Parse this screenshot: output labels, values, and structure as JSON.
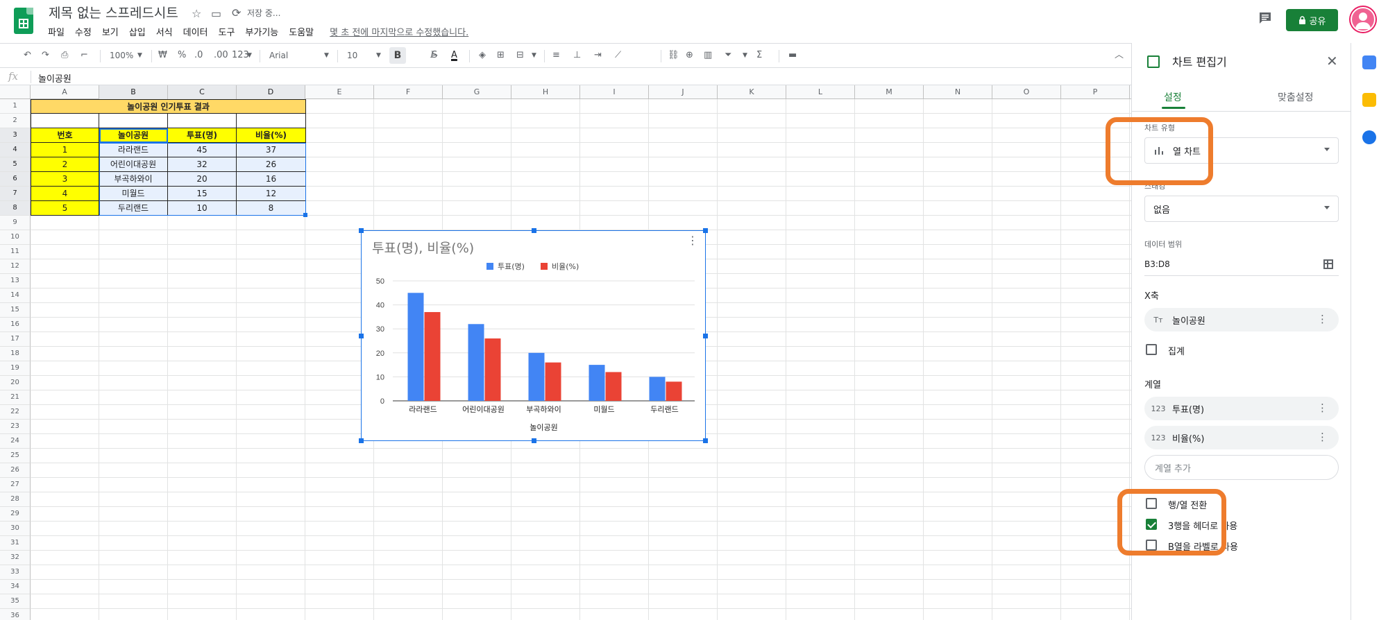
{
  "header": {
    "doc_title": "제목 없는 스프레드시트",
    "saving": "저장 중...",
    "menu": [
      "파일",
      "수정",
      "보기",
      "삽입",
      "서식",
      "데이터",
      "도구",
      "부가기능",
      "도움말"
    ],
    "last_edit": "몇 초 전에 마지막으로 수정했습니다.",
    "share_label": "공유"
  },
  "toolbar": {
    "zoom": "100%",
    "currency": "₩",
    "percent": "%",
    "dec_decrease": ".0",
    "dec_increase": ".00",
    "format": "123",
    "font": "Arial",
    "font_size": "10",
    "bold": "B",
    "italic": "I",
    "strike": "S",
    "text_color": "A",
    "sigma": "Σ"
  },
  "formula": {
    "fx": "fx",
    "value": "놀이공원"
  },
  "grid": {
    "columns": [
      "A",
      "B",
      "C",
      "D",
      "E",
      "F",
      "G",
      "H",
      "I",
      "J",
      "K",
      "L",
      "M",
      "N",
      "O",
      "P"
    ],
    "rows": [
      "1",
      "2",
      "3",
      "4",
      "5",
      "6",
      "7",
      "8",
      "9",
      "10",
      "11",
      "12",
      "13",
      "14",
      "15",
      "16",
      "17",
      "18",
      "19",
      "20",
      "21",
      "22",
      "23",
      "24",
      "25",
      "26",
      "27",
      "28",
      "29",
      "30",
      "31",
      "32",
      "33",
      "34",
      "35",
      "36"
    ],
    "table_title": "놀이공원 인기투표 결과",
    "headers": [
      "번호",
      "놀이공원",
      "투표(명)",
      "비율(%)"
    ],
    "table_rows": [
      [
        "1",
        "라라랜드",
        "45",
        "37"
      ],
      [
        "2",
        "어린이대공원",
        "32",
        "26"
      ],
      [
        "3",
        "부곡하와이",
        "20",
        "16"
      ],
      [
        "4",
        "미월드",
        "15",
        "12"
      ],
      [
        "5",
        "두리랜드",
        "10",
        "8"
      ]
    ]
  },
  "chart": {
    "title": "투표(명), 비율(%)",
    "menu_icon": "⋮"
  },
  "chart_data": {
    "type": "bar",
    "title": "투표(명), 비율(%)",
    "categories": [
      "라라랜드",
      "어린이대공원",
      "부곡하와이",
      "미월드",
      "두리랜드"
    ],
    "series": [
      {
        "name": "투표(명)",
        "values": [
          45,
          32,
          20,
          15,
          10
        ],
        "color": "#4285f4"
      },
      {
        "name": "비율(%)",
        "values": [
          37,
          26,
          16,
          12,
          8
        ],
        "color": "#ea4335"
      }
    ],
    "xlabel": "놀이공원",
    "ylabel": "",
    "ylim": [
      0,
      50
    ],
    "yticks": [
      "0",
      "10",
      "20",
      "30",
      "40",
      "50"
    ],
    "grid": true,
    "legend": "top"
  },
  "panel": {
    "title": "차트 편집기",
    "close": "✕",
    "tab_setup": "설정",
    "tab_customize": "맞춤설정",
    "chart_type_label": "차트 유형",
    "chart_type_value": "열 차트",
    "stacking_label": "스태킹",
    "stacking_value": "없음",
    "data_range_label": "데이터 범위",
    "data_range_value": "B3:D8",
    "x_axis_label": "X축",
    "x_axis_type": "Tт",
    "x_axis_value": "놀이공원",
    "aggregate_label": "집계",
    "series_label": "계열",
    "series_type": "123",
    "series": [
      "투표(명)",
      "비율(%)"
    ],
    "add_series": "계열 추가",
    "switch_rows": "행/열 전환",
    "header_row": "3행을 헤더로 사용",
    "label_col": "B열을 라벨로 사용"
  },
  "colors": {
    "accent": "#188038",
    "highlight": "#ee7c2d",
    "selection": "#1a73e8"
  }
}
